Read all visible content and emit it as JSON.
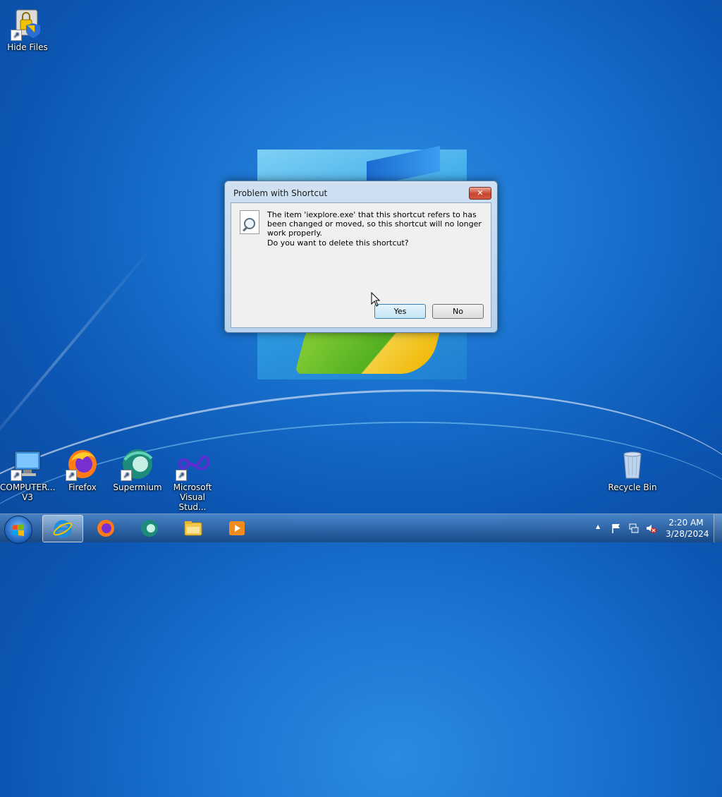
{
  "desktop": {
    "icons": [
      {
        "label": "Hide Files",
        "name": "hide-files"
      },
      {
        "label": "COMPUTER... V3",
        "line1": "COMPUTER...",
        "line2": "V3",
        "name": "computer-v3"
      },
      {
        "label": "Firefox",
        "name": "firefox"
      },
      {
        "label": "Supermium",
        "name": "supermium"
      },
      {
        "label": "Microsoft Visual Stud...",
        "line1": "Microsoft",
        "line2": "Visual Stud...",
        "name": "visual-studio"
      },
      {
        "label": "Recycle Bin",
        "name": "recycle-bin"
      }
    ]
  },
  "dialog": {
    "title": "Problem with Shortcut",
    "message": "The item 'iexplore.exe' that this shortcut refers to has been changed or moved, so this shortcut will no longer work properly.",
    "question": "Do you want to delete this shortcut?",
    "yes_label": "Yes",
    "no_label": "No",
    "close_glyph": "✕"
  },
  "taskbar": {
    "buttons": [
      "internet-explorer",
      "firefox",
      "supermium",
      "file-explorer",
      "media-player"
    ],
    "clock_time": "2:20 AM",
    "clock_date": "3/28/2024",
    "tray_chevron": "▲"
  }
}
